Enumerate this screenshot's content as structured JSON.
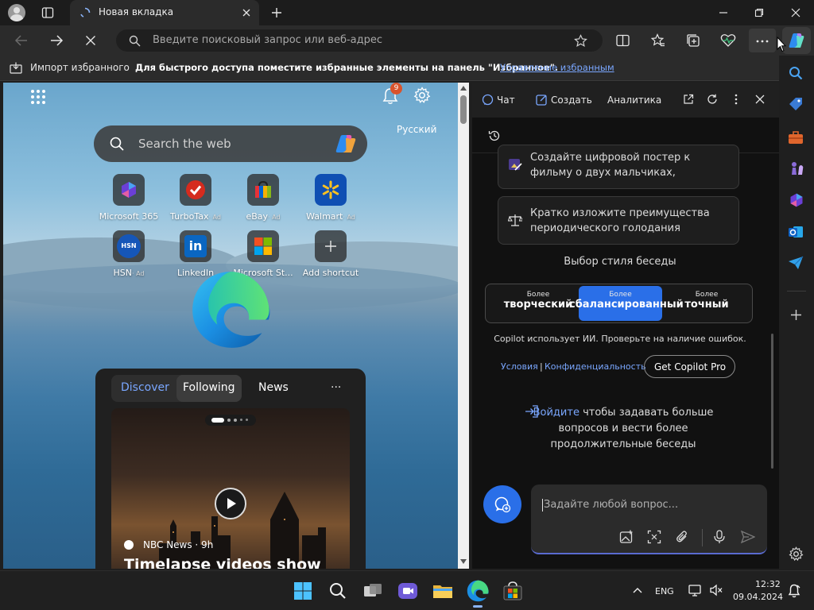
{
  "window": {
    "tab_title": "Новая вкладка"
  },
  "address_bar": {
    "placeholder": "Введите поисковый запрос или веб-адрес"
  },
  "favorites_bar": {
    "import_label": "Импорт избранного",
    "hint": "Для быстрого доступа поместите избранные элементы на панель \"Избранное\".",
    "manage_link": "Управление избранным"
  },
  "ntp": {
    "notification_count": "9",
    "language": "Русский",
    "search_placeholder": "Search the web",
    "tiles": [
      {
        "label": "Microsoft 365",
        "ad": ""
      },
      {
        "label": "TurboTax",
        "ad": "· Ad"
      },
      {
        "label": "eBay",
        "ad": "· Ad"
      },
      {
        "label": "Walmart",
        "ad": "· Ad"
      },
      {
        "label": "HSN",
        "ad": "· Ad"
      },
      {
        "label": "LinkedIn",
        "ad": ""
      },
      {
        "label": "Microsoft St...",
        "ad": ""
      },
      {
        "label": "Add shortcut",
        "ad": ""
      }
    ],
    "feed": {
      "tabs": [
        "Discover",
        "Following",
        "News"
      ],
      "more": "···",
      "source": "NBC News · 9h",
      "headline": "Timelapse videos show"
    }
  },
  "copilot": {
    "tabs": {
      "chat": "Чат",
      "create": "Создать",
      "analytics": "Аналитика"
    },
    "suggestion_1": "Создайте цифровой постер к фильму о двух мальчиках, плавающих в океане...",
    "suggestion_2": "Кратко изложите преимущества периодического голодания",
    "style_title": "Выбор стиля беседы",
    "styles": [
      {
        "small": "Более",
        "big": "творческий"
      },
      {
        "small": "Более",
        "big": "сбалансированный"
      },
      {
        "small": "Более",
        "big": "точный"
      }
    ],
    "disclaimer": "Copilot использует ИИ. Проверьте на наличие ошибок.",
    "terms": "Условия",
    "separator": "|",
    "privacy": "Конфиденциальность",
    "pro_button": "Get Copilot Pro",
    "signin_link": "Войдите",
    "signin_rest_1": " чтобы задавать больше",
    "signin_rest_2": "вопросов и вести более",
    "signin_rest_3": "продолжительные беседы",
    "input_placeholder": "Задайте любой вопрос..."
  },
  "taskbar": {
    "language": "ENG",
    "time": "12:32",
    "date": "09.04.2024"
  },
  "colors": {
    "accent": "#2a6fe8",
    "link": "#7aa7ff",
    "copilot_bg": "#111111"
  }
}
